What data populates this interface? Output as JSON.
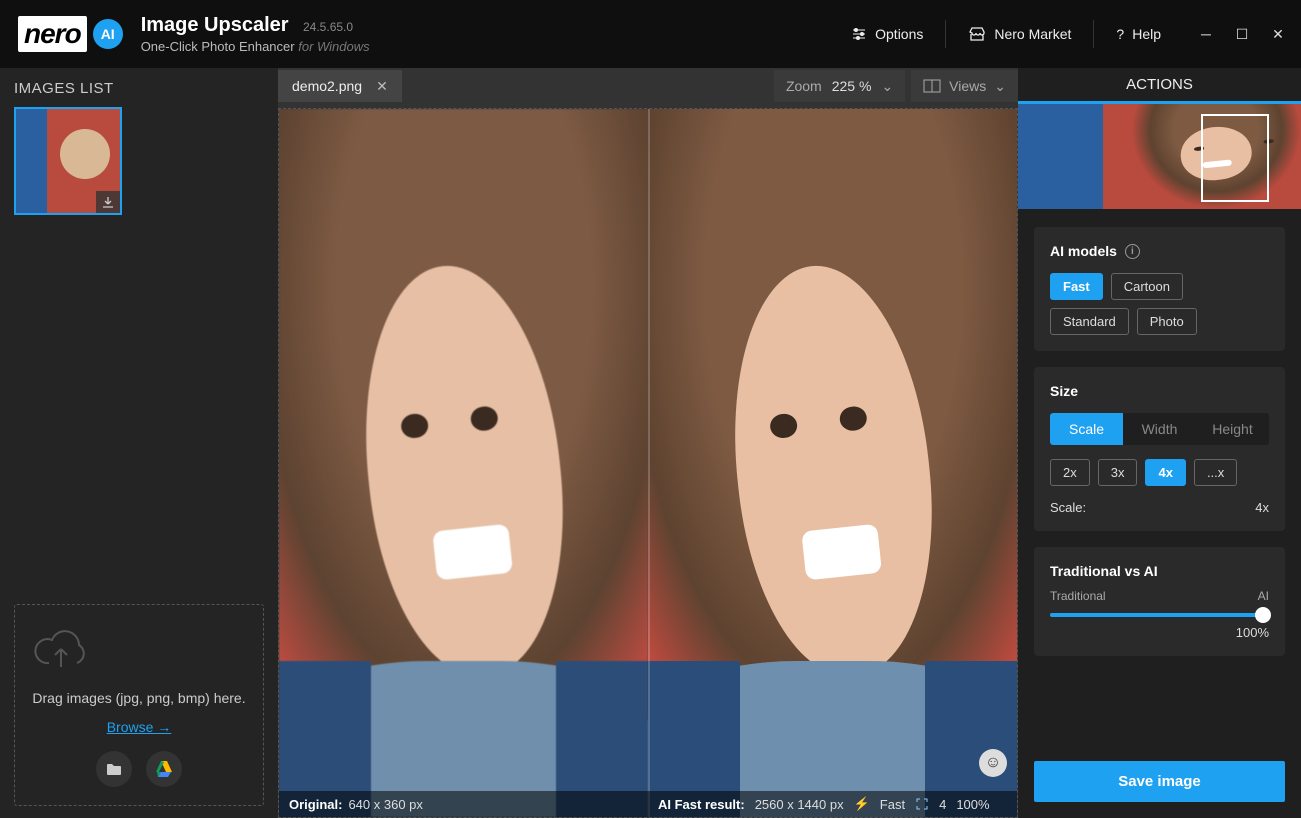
{
  "app": {
    "logo_text": "nero",
    "ai_badge": "AI",
    "title": "Image Upscaler",
    "version": "24.5.65.0",
    "subtitle": "One-Click Photo Enhancer",
    "subtitle_suffix": "for Windows"
  },
  "titlebar": {
    "options": "Options",
    "market": "Nero Market",
    "help": "Help",
    "help_prefix": "?"
  },
  "sidebar": {
    "heading": "IMAGES LIST",
    "drop_text": "Drag images (jpg, png, bmp) here.",
    "browse": "Browse →"
  },
  "center": {
    "tab_name": "demo2.png",
    "zoom_label": "Zoom",
    "zoom_value": "225 %",
    "views_label": "Views",
    "orig_label": "Original:",
    "orig_dims": "640 x 360 px",
    "result_label": "AI Fast result:",
    "result_dims": "2560 x 1440 px",
    "badge_fast": "Fast",
    "scale_num": "4",
    "pct": "100%"
  },
  "panel": {
    "heading": "ACTIONS",
    "models_heading": "AI models",
    "models": [
      "Fast",
      "Cartoon",
      "Standard",
      "Photo"
    ],
    "model_active": "Fast",
    "size_heading": "Size",
    "size_tabs": [
      "Scale",
      "Width",
      "Height"
    ],
    "size_tab_active": "Scale",
    "scale_opts": [
      "2x",
      "3x",
      "4x",
      "...x"
    ],
    "scale_active": "4x",
    "scale_label": "Scale:",
    "scale_value": "4x",
    "tvai_heading": "Traditional vs AI",
    "tvai_left": "Traditional",
    "tvai_right": "AI",
    "tvai_pct": "100%",
    "save": "Save image"
  }
}
